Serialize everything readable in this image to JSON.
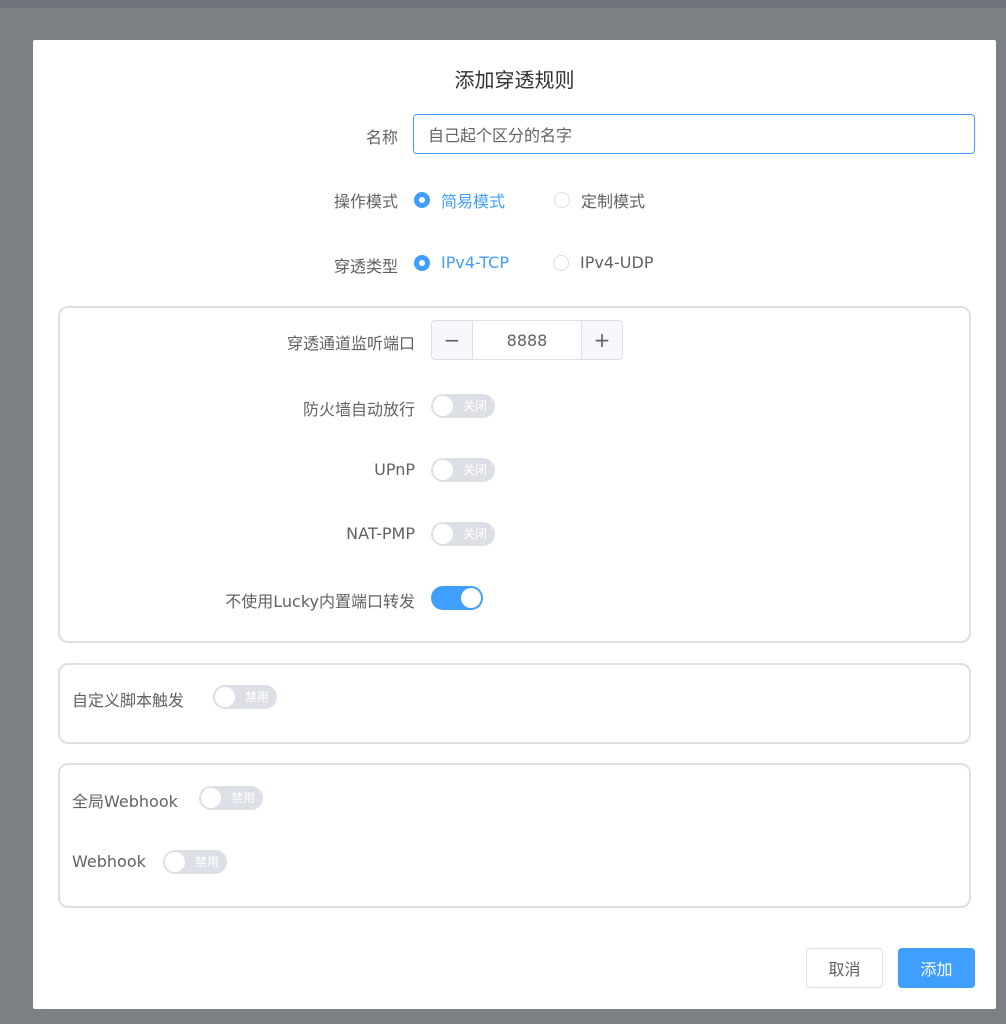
{
  "dialog": {
    "title": "添加穿透规则"
  },
  "form": {
    "name_label": "名称",
    "name_value": "自己起个区分的名字",
    "mode_label": "操作模式",
    "mode_options": [
      "简易模式",
      "定制模式"
    ],
    "mode_selected": "简易模式",
    "type_label": "穿透类型",
    "type_options": [
      "IPv4-TCP",
      "IPv4-UDP"
    ],
    "type_selected": "IPv4-TCP"
  },
  "port_panel": {
    "port_label": "穿透通道监听端口",
    "port_value": "8888",
    "port_minus": "−",
    "port_plus": "+",
    "firewall_label": "防火墙自动放行",
    "firewall_state": "关闭",
    "upnp_label": "UPnP",
    "upnp_state": "关闭",
    "natpmp_label": "NAT-PMP",
    "natpmp_state": "关闭",
    "no_lucky_forward_label": "不使用Lucky内置端口转发",
    "no_lucky_forward_on": true
  },
  "script_panel": {
    "script_label": "自定义脚本触发",
    "script_state": "禁用"
  },
  "webhook_panel": {
    "global_webhook_label": "全局Webhook",
    "global_webhook_state": "禁用",
    "webhook_label": "Webhook",
    "webhook_state": "禁用"
  },
  "footer": {
    "cancel_label": "取消",
    "add_label": "添加"
  },
  "colors": {
    "accent": "#409eff",
    "switch_off": "#dcdfe6",
    "text": "#606266",
    "title": "#303133"
  }
}
